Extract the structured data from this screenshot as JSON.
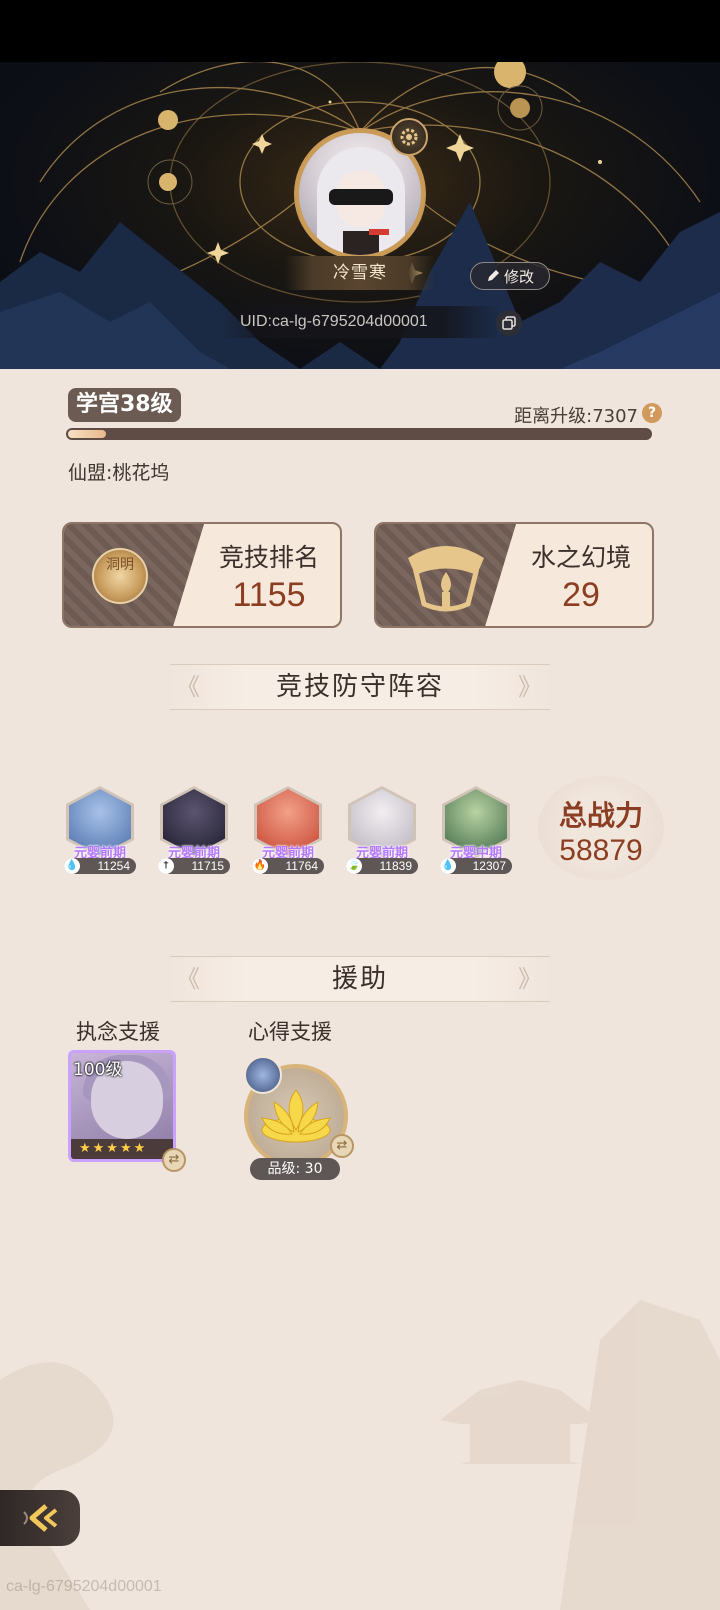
{
  "profile": {
    "name": "冷雪寒",
    "edit_label": "修改",
    "uid": "UID:ca-lg-6795204d00001"
  },
  "level": {
    "title": "学宫38级",
    "to_next": "距离升级:7307",
    "progress": 0.065,
    "help": "?"
  },
  "guild": "仙盟:桃花坞",
  "stats": [
    {
      "title": "竞技排名",
      "value": "1155",
      "icon": "medal-icon",
      "medal_text": "洞明"
    },
    {
      "title": "水之幻境",
      "value": "29",
      "icon": "water-realm-emblem"
    }
  ],
  "defense": {
    "title": "竞技防守阵容",
    "heroes": [
      {
        "rank": "元婴前期",
        "power": "11254",
        "type_icon": "water-drop-icon",
        "colors": [
          "#a9c1e8",
          "#4a6fa8"
        ]
      },
      {
        "rank": "元婴前期",
        "power": "11715",
        "type_icon": "sword-icon",
        "colors": [
          "#5b5570",
          "#1c1a2a"
        ]
      },
      {
        "rank": "元婴前期",
        "power": "11764",
        "type_icon": "flame-icon",
        "colors": [
          "#f2a08a",
          "#c4432e"
        ]
      },
      {
        "rank": "元婴前期",
        "power": "11839",
        "type_icon": "leaf-icon",
        "colors": [
          "#f2eef0",
          "#b8b2bd"
        ]
      },
      {
        "rank": "元婴中期",
        "power": "12307",
        "type_icon": "water-drop-icon",
        "colors": [
          "#b9d2a2",
          "#3e6848"
        ]
      }
    ],
    "total_label": "总战力",
    "total_value": "58879"
  },
  "support": {
    "title": "援助",
    "left_label": "执念支援",
    "right_label": "心得支援",
    "card_level": "100级",
    "card_stars": "★★★★★",
    "grade": "品级: 30"
  },
  "watermark": "ca-lg-6795204d00001",
  "colors": {
    "accent_brown": "#8c3e22",
    "panel": "#efe5dd",
    "gold": "#c9a36b"
  }
}
